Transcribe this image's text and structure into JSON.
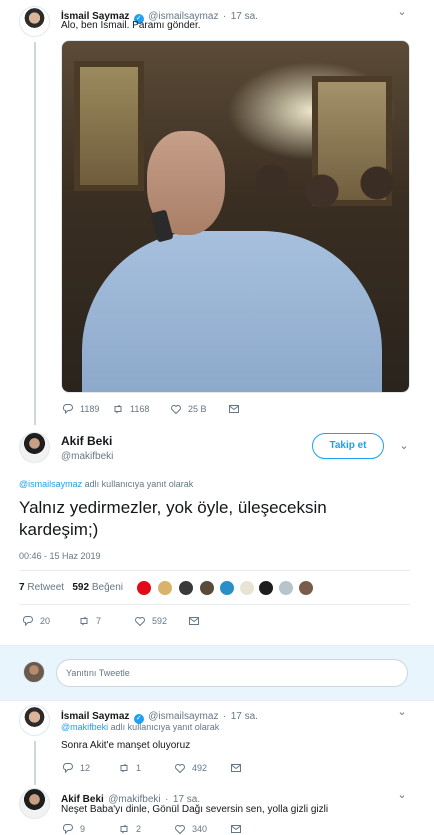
{
  "tweet1": {
    "name": "İsmail Saymaz",
    "handle": "@ismailsaymaz",
    "dot": "·",
    "time": "17 sa.",
    "text": "Alo, ben İsmail. Paramı gönder.",
    "actions": {
      "replies": "1189",
      "retweets": "1168",
      "likes": "25 B"
    }
  },
  "main_tweet": {
    "name": "Akif Beki",
    "handle": "@makifbeki",
    "follow_label": "Takip et",
    "reply_to_handle": "@ismailsaymaz",
    "reply_to_suffix": "adlı kullanıcıya yanıt olarak",
    "text": "Yalnız yedirmezler, yok öyle, üleşeceksin kardeşim;)",
    "timestamp": "00:46 - 15 Haz 2019",
    "retweet_count": "7",
    "retweet_label": "Retweet",
    "like_count": "592",
    "like_label": "Beğeni",
    "actions": {
      "replies": "20",
      "retweets": "7",
      "likes": "592"
    }
  },
  "reply_input": {
    "placeholder": "Yanıtını Tweetle"
  },
  "reply1": {
    "name": "İsmail Saymaz",
    "handle": "@ismailsaymaz",
    "dot": "·",
    "time": "17 sa.",
    "reply_to_handle": "@makifbeki",
    "reply_to_suffix": "adlı kullanıcıya yanıt olarak",
    "text": "Sonra Akit'e manşet oluyoruz",
    "actions": {
      "replies": "12",
      "retweets": "1",
      "likes": "492"
    }
  },
  "reply2": {
    "name": "Akif Beki",
    "handle": "@makifbeki",
    "dot": "·",
    "time": "17 sa.",
    "text": "Neşet Baba'yı dinle, Gönül Dağı seversin sen, yolla gizli gizli",
    "actions": {
      "replies": "9",
      "retweets": "2",
      "likes": "340"
    }
  },
  "colors": {
    "accent": "#1da1f2",
    "text": "#14171a",
    "secondary": "#657786",
    "border": "#e6ecf0"
  },
  "icons": [
    "reply-icon",
    "retweet-icon",
    "heart-icon",
    "mail-icon",
    "chevron-down-icon",
    "verified-icon"
  ]
}
